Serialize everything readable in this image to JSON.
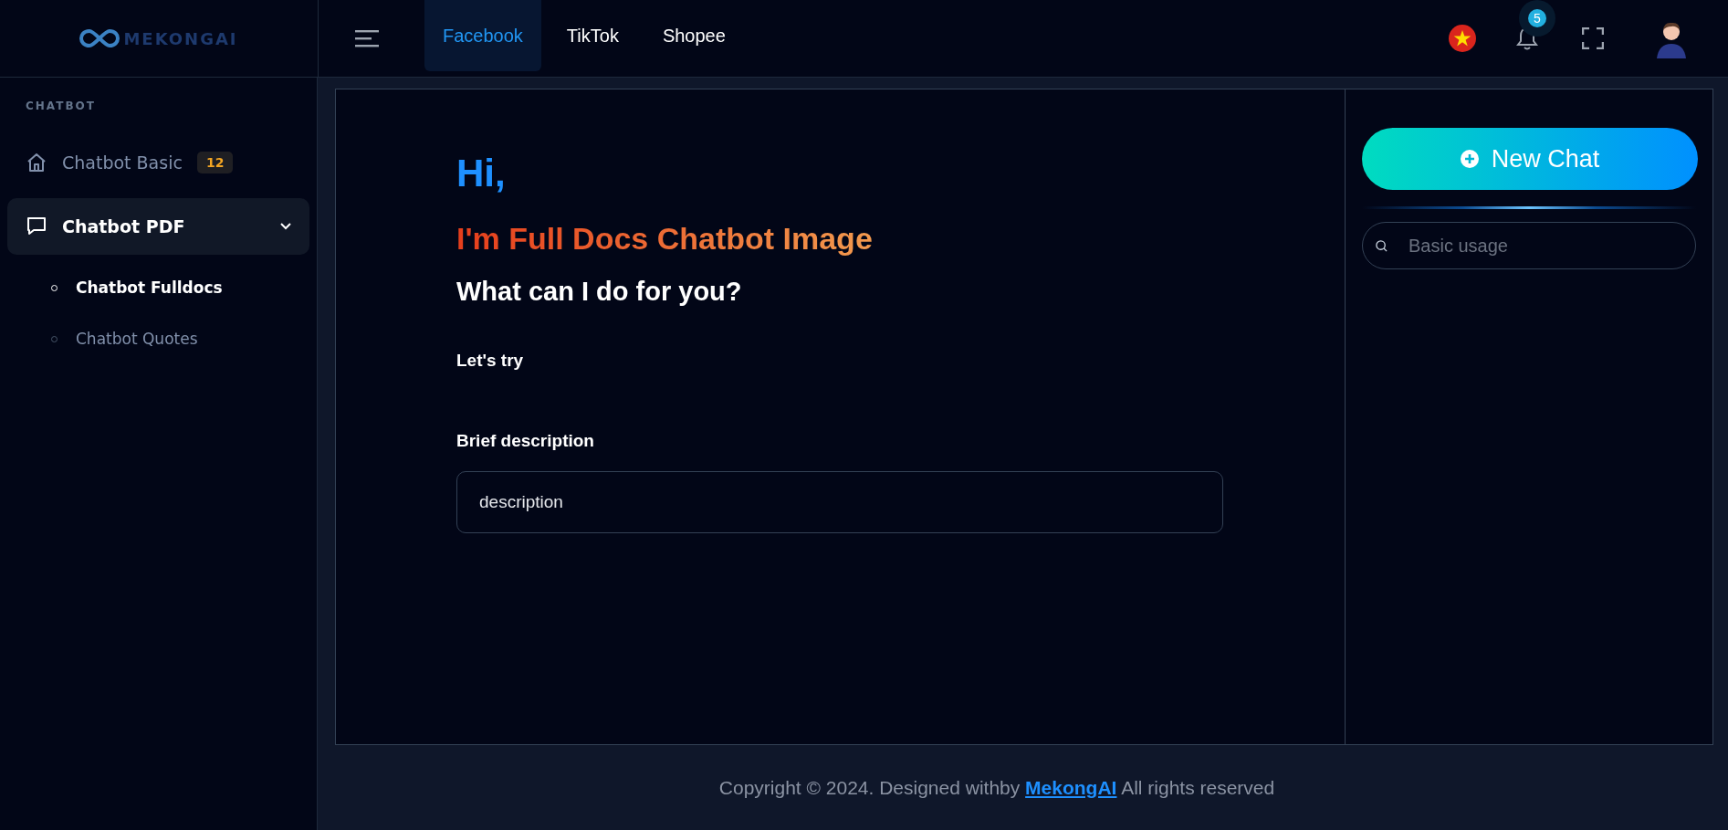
{
  "header": {
    "logo_text": "MEKONGAI",
    "tabs": [
      {
        "label": "Facebook",
        "selected": true
      },
      {
        "label": "TikTok",
        "selected": false
      },
      {
        "label": "Shopee",
        "selected": false
      }
    ],
    "notification_count": "5"
  },
  "sidebar": {
    "section_label": "CHATBOT",
    "items": [
      {
        "label": "Chatbot Basic",
        "kind": "link",
        "badge": "12",
        "selected": false
      },
      {
        "label": "Chatbot PDF",
        "kind": "group",
        "selected": true,
        "expanded": true,
        "children": [
          {
            "label": "Chatbot Fulldocs",
            "selected": true
          },
          {
            "label": "Chatbot Quotes",
            "selected": false
          }
        ]
      }
    ]
  },
  "main": {
    "greeting": "Hi,",
    "title": "I'm Full Docs Chatbot Image",
    "subtitle": "What can I do for you?",
    "try_label": "Let's try",
    "description_label": "Brief description",
    "description_placeholder": "description"
  },
  "chat_panel": {
    "new_chat_label": "New Chat",
    "search_placeholder": "Basic usage"
  },
  "footer": {
    "before": "Copyright © 2024. Designed withby",
    "link": "MekongAI",
    "after": "All rights reserved"
  }
}
